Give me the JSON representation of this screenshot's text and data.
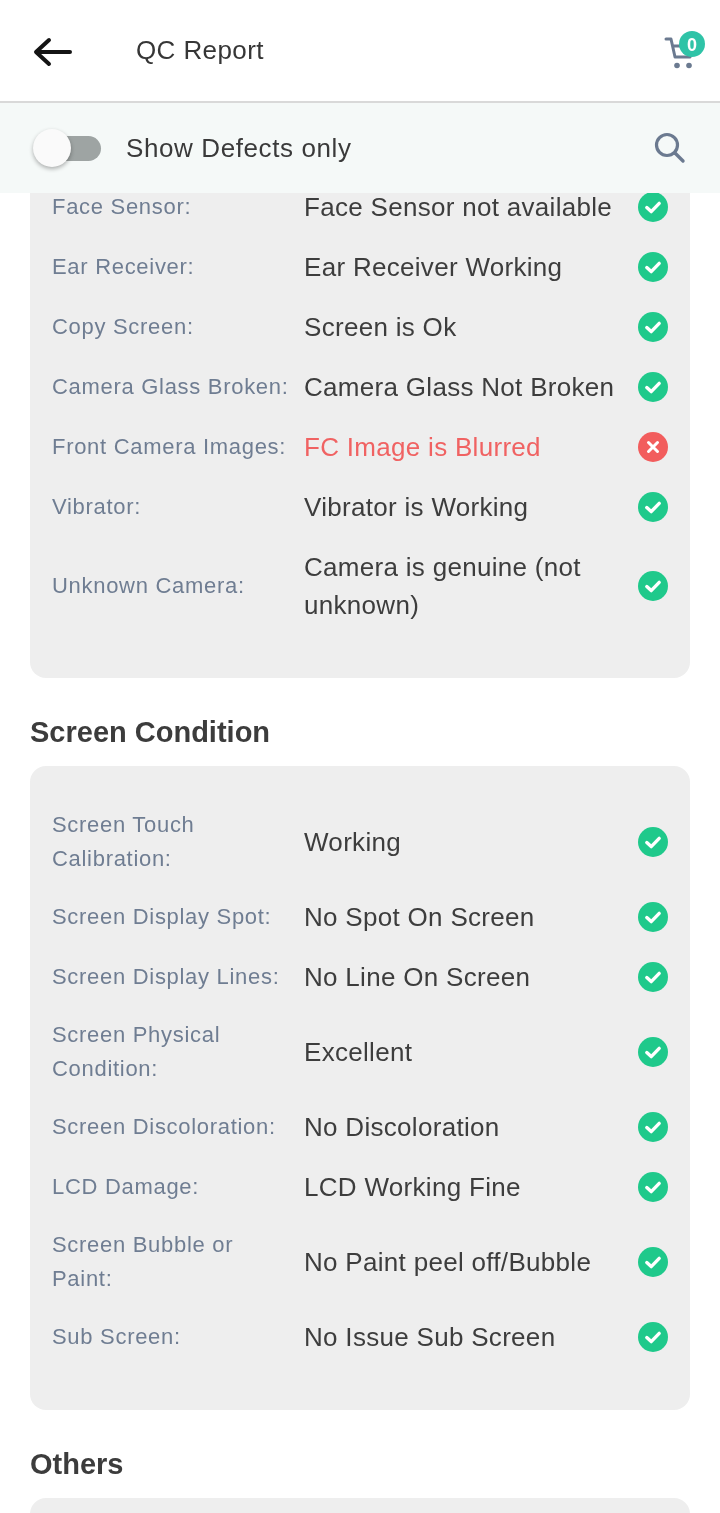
{
  "header": {
    "title": "QC Report",
    "cart_count": "0"
  },
  "filter": {
    "label": "Show Defects only",
    "on": false
  },
  "sections": [
    {
      "items": [
        {
          "label": "Face Sensor:",
          "value": "Face Sensor not available",
          "passed": true
        },
        {
          "label": "Ear Receiver:",
          "value": "Ear Receiver Working",
          "passed": true
        },
        {
          "label": "Copy Screen:",
          "value": "Screen is Ok",
          "passed": true
        },
        {
          "label": "Camera Glass Broken:",
          "value": "Camera Glass Not Broken",
          "passed": true
        },
        {
          "label": "Front Camera Images:",
          "value": "FC Image is Blurred",
          "passed": false
        },
        {
          "label": "Vibrator:",
          "value": "Vibrator is Working",
          "passed": true
        },
        {
          "label": "Unknown Camera:",
          "value": "Camera is genuine (not unknown)",
          "passed": true
        }
      ]
    },
    {
      "title": "Screen Condition",
      "items": [
        {
          "label": "Screen Touch Calibration:",
          "value": "Working",
          "passed": true
        },
        {
          "label": "Screen Display Spot:",
          "value": "No Spot On Screen",
          "passed": true
        },
        {
          "label": "Screen Display Lines:",
          "value": "No Line On Screen",
          "passed": true
        },
        {
          "label": "Screen Physical Condition:",
          "value": "Excellent",
          "passed": true
        },
        {
          "label": "Screen Discoloration:",
          "value": "No Discoloration",
          "passed": true
        },
        {
          "label": "LCD Damage:",
          "value": "LCD Working Fine",
          "passed": true
        },
        {
          "label": "Screen Bubble or Paint:",
          "value": "No Paint peel off/Bubble",
          "passed": true
        },
        {
          "label": "Sub Screen:",
          "value": "No Issue Sub Screen",
          "passed": true
        }
      ]
    },
    {
      "title": "Others"
    }
  ]
}
